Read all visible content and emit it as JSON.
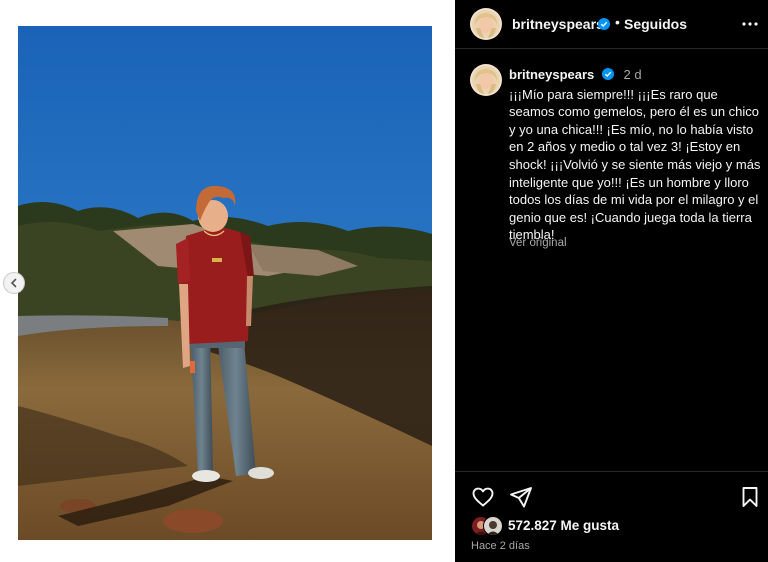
{
  "post": {
    "username": "britneyspears",
    "follow_status": "Seguidos",
    "separator": "•"
  },
  "comment": {
    "username": "britneyspears",
    "time_ago": "2 d",
    "caption": "¡¡¡Mío para siempre!!! ¡¡¡Es raro que seamos como gemelos, pero él es un chico y yo una chica!!! ¡Es mío, no lo había visto en 2 años y medio o tal vez 3! ¡Estoy en shock! ¡¡¡Volvió y se siente más viejo y más inteligente que yo!!! ¡Es un hombre y lloro todos los días de mi vida por el milagro y el genio que es! ¡Cuando juega toda la tierra tiembla!",
    "see_original": "Ver original"
  },
  "footer": {
    "likes": "572.827 Me gusta",
    "timestamp": "Hace 2 días"
  },
  "icons": {
    "verified": "verified-badge-icon",
    "more": "more-options-icon",
    "like": "heart-icon",
    "share": "paper-plane-icon",
    "save": "bookmark-icon",
    "prev": "chevron-left-icon"
  },
  "colors": {
    "dark_bg": "#000000",
    "text": "#f5f5f5",
    "muted": "#a8a8a8",
    "verified": "#0095f6",
    "divider": "#262626",
    "sky": "#1f6fc0",
    "shirt": "#9a1d1e"
  }
}
